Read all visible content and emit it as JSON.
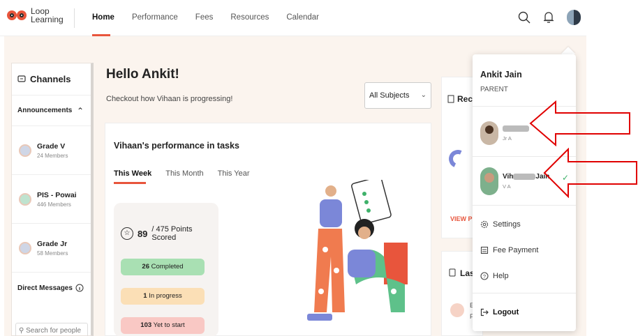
{
  "header": {
    "logo_line1": "Loop",
    "logo_line2": "Learning",
    "nav": [
      "Home",
      "Performance",
      "Fees",
      "Resources",
      "Calendar"
    ]
  },
  "channels": {
    "title": "Channels",
    "announcements": "Announcements",
    "groups": [
      {
        "name": "Grade V",
        "members": "24 Members"
      },
      {
        "name": "PIS - Powai",
        "members": "446 Members"
      },
      {
        "name": "Grade Jr",
        "members": "58 Members"
      }
    ],
    "direct_messages": "Direct Messages",
    "search_placeholder": "Search for people"
  },
  "main": {
    "greeting": "Hello Ankit!",
    "subtitle": "Checkout how Vihaan is progressing!",
    "subject_select": "All Subjects",
    "performance_title": "Vihaan's performance in tasks",
    "tabs": [
      "This Week",
      "This Month",
      "This Year"
    ],
    "points_value": "89",
    "points_total": "/ 475 Points Scored",
    "completed_count": "26",
    "completed_label": "Completed",
    "in_progress_count": "1",
    "in_progress_label": "In progress",
    "yet_count": "103",
    "yet_label": "Yet to start"
  },
  "right": {
    "rec_title": "Rec",
    "view_link": "VIEW PE",
    "last_title": "Las",
    "last_initial": "E",
    "last_initial2": "F"
  },
  "dropdown": {
    "name": "Ankit Jain",
    "role": "PARENT",
    "child1_class": "Jr A",
    "child2_prefix": "Vih",
    "child2_suffix": "Jain",
    "child2_class": "V A",
    "settings": "Settings",
    "fee_payment": "Fee Payment",
    "help": "Help",
    "logout": "Logout"
  },
  "colors": {
    "accent": "#e8553c",
    "annotation_arrow": "#e00000",
    "completed": "#a9e0b3",
    "in_progress": "#fbdfb6",
    "yet_to_start": "#f9c8c4"
  }
}
